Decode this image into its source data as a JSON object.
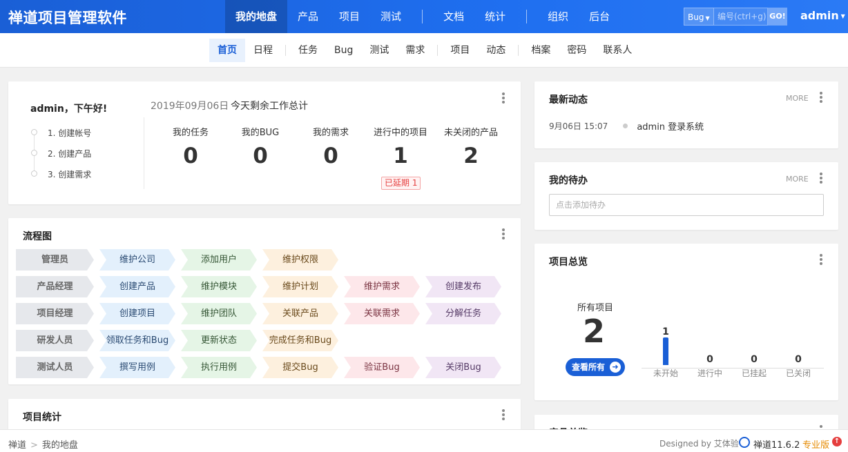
{
  "header": {
    "brand": "禅道项目管理软件",
    "nav": [
      "我的地盘",
      "产品",
      "项目",
      "测试",
      "文档",
      "统计",
      "组织",
      "后台"
    ],
    "search_type": "Bug",
    "search_placeholder": "编号(ctrl+g)",
    "search_go": "GO!",
    "user": "admin"
  },
  "subnav": [
    "首页",
    "日程",
    "任务",
    "Bug",
    "测试",
    "需求",
    "项目",
    "动态",
    "档案",
    "密码",
    "联系人"
  ],
  "welcome": {
    "greeting": "admin，下午好!",
    "steps": [
      "1. 创建帐号",
      "2. 创建产品",
      "3. 创建需求"
    ],
    "date": "2019年09月06日",
    "date_subtitle": "今天剩余工作总计",
    "stats": [
      {
        "label": "我的任务",
        "value": "0"
      },
      {
        "label": "我的BUG",
        "value": "0"
      },
      {
        "label": "我的需求",
        "value": "0"
      },
      {
        "label": "进行中的项目",
        "value": "1"
      },
      {
        "label": "未关闭的产品",
        "value": "2"
      }
    ],
    "delay_badge": "已延期 1"
  },
  "flowchart": {
    "title": "流程图",
    "rows": [
      {
        "role": "管理员",
        "steps": [
          "维护公司",
          "添加用户",
          "维护权限"
        ]
      },
      {
        "role": "产品经理",
        "steps": [
          "创建产品",
          "维护模块",
          "维护计划",
          "维护需求",
          "创建发布"
        ]
      },
      {
        "role": "项目经理",
        "steps": [
          "创建项目",
          "维护团队",
          "关联产品",
          "关联需求",
          "分解任务"
        ]
      },
      {
        "role": "研发人员",
        "steps": [
          "领取任务和Bug",
          "更新状态",
          "完成任务和Bug"
        ]
      },
      {
        "role": "测试人员",
        "steps": [
          "撰写用例",
          "执行用例",
          "提交Bug",
          "验证Bug",
          "关闭Bug"
        ]
      }
    ],
    "colors": [
      "#e3f0fc",
      "#e5f5e6",
      "#fdf0de",
      "#fde7ea",
      "#f1e6f5"
    ]
  },
  "project_stats": {
    "title": "项目统计"
  },
  "activity": {
    "title": "最新动态",
    "more": "MORE",
    "items": [
      {
        "time": "9月06日 15:07",
        "text": "admin 登录系统"
      }
    ]
  },
  "todo": {
    "title": "我的待办",
    "more": "MORE",
    "placeholder": "点击添加待办"
  },
  "project_overview": {
    "title": "项目总览",
    "all_label": "所有项目",
    "all_count": "2",
    "view_all": "查看所有",
    "statuses": [
      {
        "label": "未开始",
        "value": 1
      },
      {
        "label": "进行中",
        "value": 0
      },
      {
        "label": "已挂起",
        "value": 0
      },
      {
        "label": "已关闭",
        "value": 0
      }
    ]
  },
  "product_overview": {
    "title": "产品总览"
  },
  "footer": {
    "crumbs": [
      "禅道",
      "我的地盘"
    ],
    "designed_by": "Designed by 艾体验",
    "version": "禅道11.6.2",
    "edition": "专业版"
  },
  "accent": "#1a5fd6"
}
